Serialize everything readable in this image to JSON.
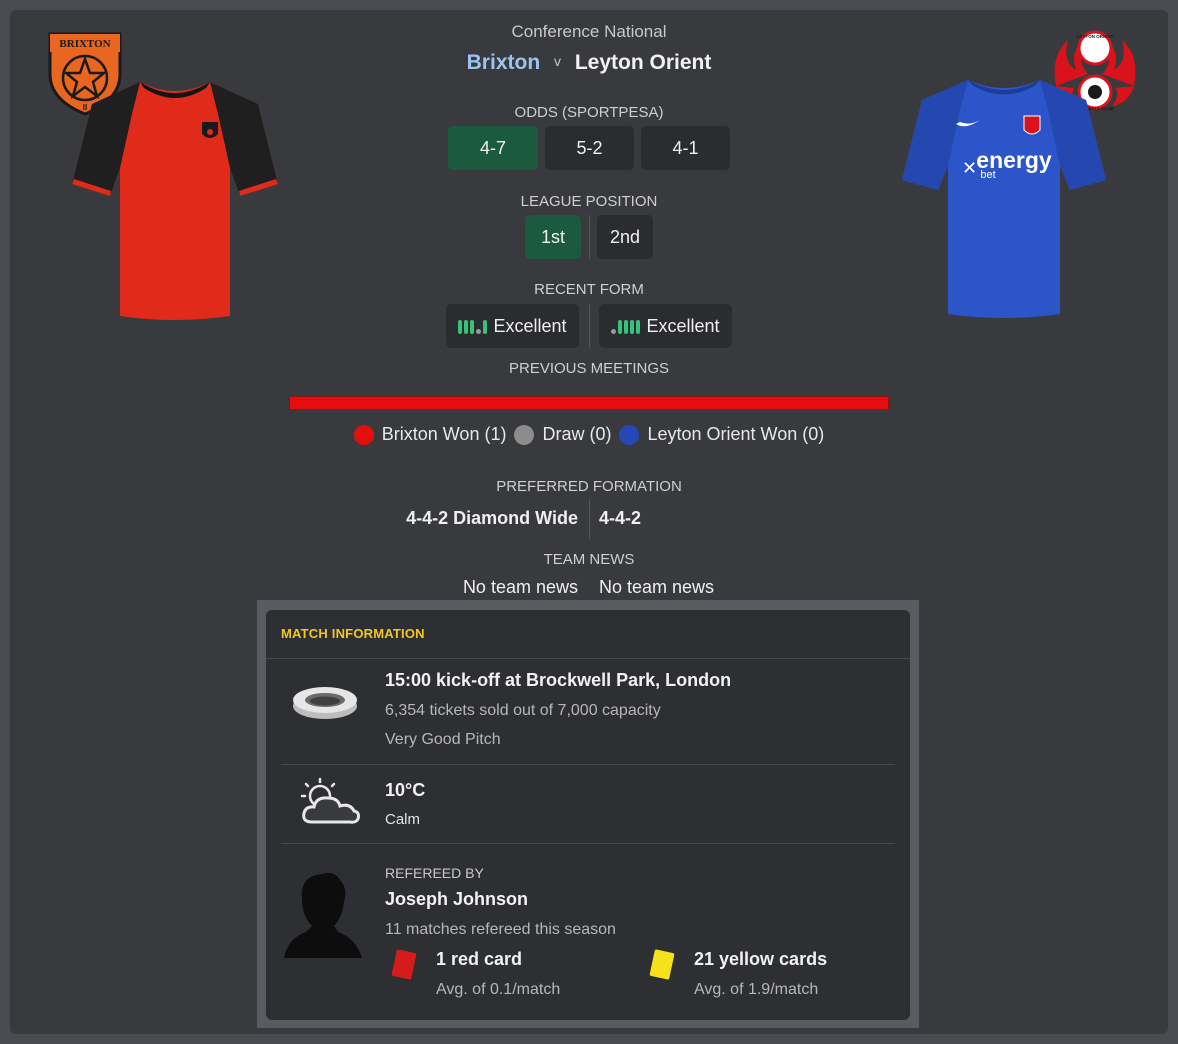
{
  "header": {
    "competition": "Conference National",
    "home_team": "Brixton",
    "vs": "v",
    "away_team": "Leyton Orient"
  },
  "odds": {
    "label": "ODDS (SPORTPESA)",
    "home": "4-7",
    "draw": "5-2",
    "away": "4-1"
  },
  "league_position": {
    "label": "LEAGUE POSITION",
    "home": "1st",
    "away": "2nd"
  },
  "recent_form": {
    "label": "RECENT FORM",
    "home": "Excellent",
    "away": "Excellent"
  },
  "previous_meetings": {
    "label": "PREVIOUS MEETINGS",
    "home_won": "Brixton Won (1)",
    "draw": "Draw (0)",
    "away_won": "Leyton Orient Won (0)",
    "home_wins": 1,
    "draws": 0,
    "away_wins": 0,
    "colors": {
      "home": "#e50d0d",
      "draw": "#8c8c8c",
      "away": "#2647b8"
    }
  },
  "preferred_formation": {
    "label": "PREFERRED FORMATION",
    "home": "4-4-2 Diamond Wide",
    "away": "4-4-2"
  },
  "team_news": {
    "label": "TEAM NEWS",
    "home": "No team news",
    "away": "No team news"
  },
  "match_information": {
    "title": "MATCH INFORMATION",
    "venue_line": "15:00 kick-off at Brockwell Park, London",
    "tickets_line": "6,354 tickets sold out of 7,000 capacity",
    "pitch_line": "Very Good Pitch",
    "temperature": "10°C",
    "wind": "Calm",
    "referee_label": "REFEREED BY",
    "referee_name": "Joseph Johnson",
    "referee_matches": "11 matches refereed this season",
    "red_cards": "1 red card",
    "red_avg": "Avg. of 0.1/match",
    "yellow_cards": "21 yellow cards",
    "yellow_avg": "Avg. of 1.9/match"
  },
  "badges": {
    "home_badge_text": "BRIXTON",
    "home_badge_sub": "II",
    "away_badge_text": "LEYTON ORIENT",
    "away_badge_sub": "FOOTBALL CLUB"
  },
  "kits": {
    "away_sponsor": "energy",
    "away_sponsor_sub": "bet"
  },
  "colors": {
    "home_primary": "#e02a1a",
    "away_primary": "#2b55c9",
    "accent_green": "#1c5a3f",
    "title_yellow": "#f3c623"
  }
}
